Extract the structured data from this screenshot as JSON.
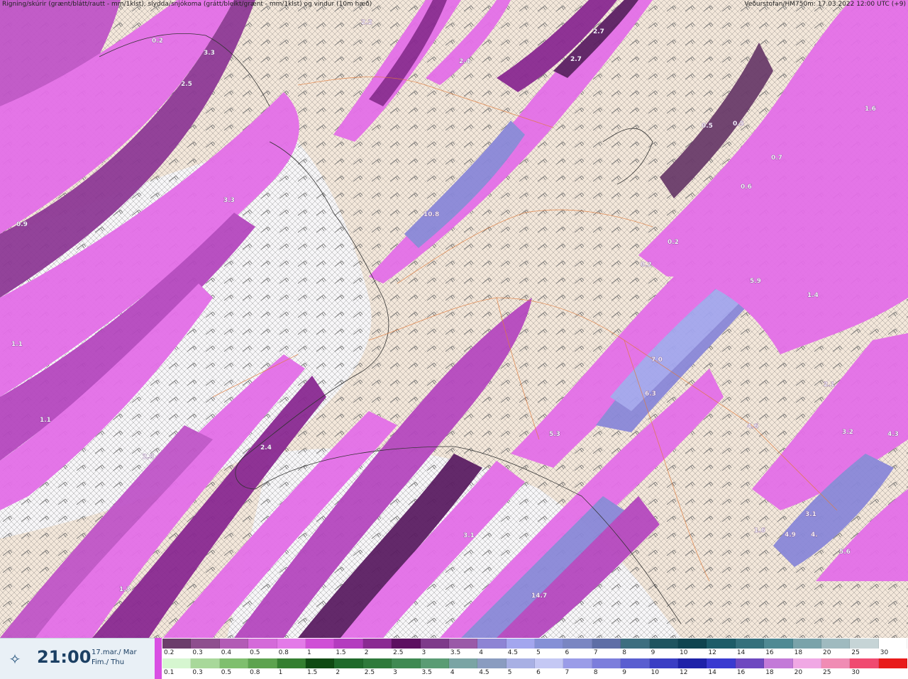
{
  "header": {
    "left": "Rigning/skúrir (grænt/blátt/rautt - mm/1klst), slydda/snjókoma (grátt/bleikt/grænt - mm/1klst) og vindur (10m hæð)",
    "right": "Veðurstofan/HM750m: 17.03.2022 12:00 UTC (+9)"
  },
  "time_panel": {
    "time": "21:00",
    "date_line1": "17.mar./ Mar",
    "date_line2": "Fim./ Thu",
    "logo_icon": "vedur-logo-icon"
  },
  "legend": {
    "snow_colors": [
      "#6b3d6b",
      "#8e4f8e",
      "#b25bb5",
      "#d46ad9",
      "#e37ae8",
      "#cf4fd6",
      "#b43cbf",
      "#8a2a92",
      "#5c1060",
      "#7e3a8a",
      "#9a5aa8",
      "#8e84d4",
      "#a3a6ee",
      "#8590d6",
      "#7a86c2",
      "#5e6ea6",
      "#3d6e80",
      "#1f5460",
      "#0f4450",
      "#1d5c68",
      "#34707c",
      "#4f8a94",
      "#7aa3aa",
      "#9fbabf",
      "#c6d4d6",
      "#ffffff"
    ],
    "snow_labels": [
      "0.2",
      "0.3",
      "0.4",
      "0.5",
      "0.8",
      "1",
      "1.5",
      "2",
      "2.5",
      "3",
      "3.5",
      "4",
      "4.5",
      "5",
      "6",
      "7",
      "8",
      "9",
      "10",
      "12",
      "14",
      "16",
      "18",
      "20",
      "25",
      "30"
    ],
    "rain_colors": [
      "#d6f6d0",
      "#a8d89a",
      "#7fbf6e",
      "#5da34f",
      "#347f30",
      "#0f4a12",
      "#1f6a2a",
      "#2e7a3a",
      "#3f8a52",
      "#5a9c74",
      "#7aa4a4",
      "#8a9cc0",
      "#a8b0e4",
      "#c4c8f4",
      "#9a9ce8",
      "#7c7edc",
      "#5a5ed0",
      "#3a3ec4",
      "#1e22a8",
      "#3a3ad0",
      "#6e48c0",
      "#c37ad8",
      "#f0a8e4",
      "#f08cb4",
      "#f04a70",
      "#e81a1a"
    ],
    "rain_labels": [
      "0.1",
      "0.3",
      "0.5",
      "0.8",
      "1",
      "1.5",
      "2",
      "2.5",
      "3",
      "3.5",
      "4",
      "4.5",
      "5",
      "6",
      "7",
      "8",
      "9",
      "10",
      "12",
      "14",
      "16",
      "18",
      "20",
      "25",
      "30",
      ""
    ]
  },
  "map_labels": [
    "0.2",
    "3.3",
    "2.5",
    "2.2",
    "2.4",
    "2.7",
    "2.7",
    "1.6",
    "0.5",
    "0.5",
    "0.7",
    "0.6",
    "3.3",
    "0.9",
    "10.8",
    "0.2",
    "0.2",
    "5.9",
    "1.4",
    "1.1",
    "7.0",
    "6.3",
    "2.1",
    "1.1",
    "2.4",
    "2.8",
    "5.3",
    "4.6",
    "3.2",
    "4.3",
    "3.1",
    "3.1",
    "4.9",
    "4.",
    "5.6",
    "1.6",
    "1.3",
    "14.7"
  ],
  "colors": {
    "land": "#f3e7da",
    "sea_snow": "#f7f6f8",
    "precip_light": "#e46fe8",
    "precip_mid": "#b548bf",
    "precip_dark": "#5c1f63",
    "precip_heavy": "#8a88d8",
    "roads": "#e07a3a"
  }
}
